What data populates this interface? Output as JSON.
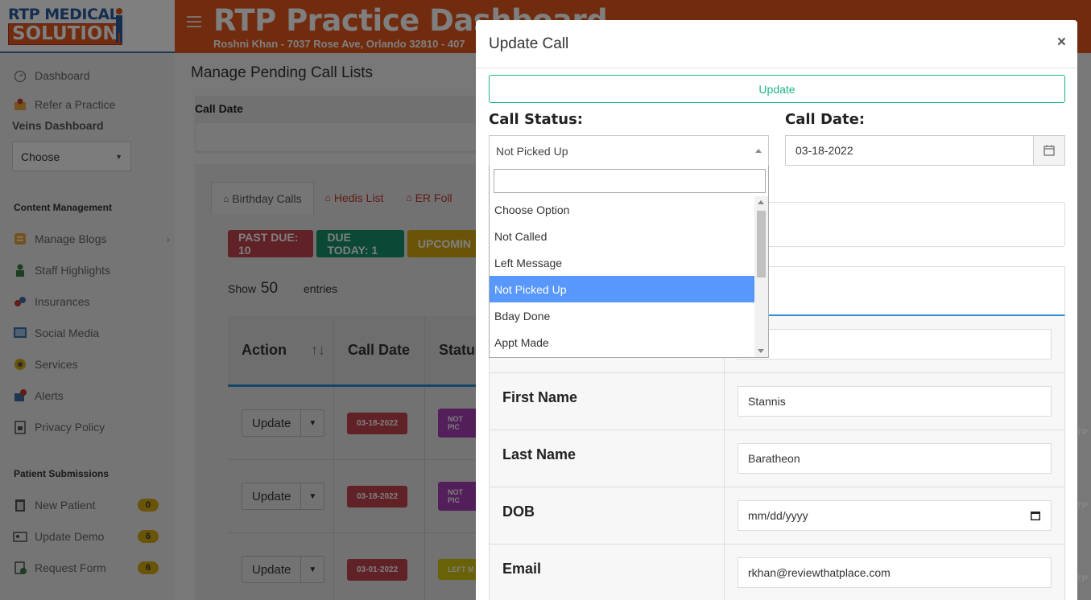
{
  "logo": {
    "line1": "RTP MEDICAL",
    "line2": "SOLUTION"
  },
  "header": {
    "title": "RTP Practice Dashboard",
    "subtitle": "Roshni Khan - 7037 Rose Ave, Orlando 32810 - 407",
    "bg_color": "#e2571c"
  },
  "sidebar": {
    "top_items": [
      {
        "label": "Dashboard",
        "icon": "gauge-icon"
      },
      {
        "label": "Refer a Practice",
        "icon": "refer-icon"
      }
    ],
    "veins_heading": "Veins Dashboard",
    "veins_select": "Choose",
    "content_heading": "Content Management",
    "content_items": [
      {
        "label": "Manage Blogs",
        "icon": "blog-icon"
      },
      {
        "label": "Staff Highlights",
        "icon": "staff-icon"
      },
      {
        "label": "Insurances",
        "icon": "insurance-icon"
      },
      {
        "label": "Social Media",
        "icon": "social-icon"
      },
      {
        "label": "Services",
        "icon": "services-icon"
      },
      {
        "label": "Alerts",
        "icon": "alert-icon"
      },
      {
        "label": "Privacy Policy",
        "icon": "privacy-icon"
      }
    ],
    "patient_heading": "Patient Submissions",
    "patient_items": [
      {
        "label": "New Patient",
        "count": "0",
        "icon": "clipboard-icon"
      },
      {
        "label": "Update Demo",
        "count": "6",
        "icon": "id-card-icon"
      },
      {
        "label": "Request Form",
        "count": "6",
        "icon": "form-icon"
      }
    ]
  },
  "main": {
    "page_title": "Manage Pending Call Lists",
    "filter_label": "Call Date",
    "tabs": [
      {
        "label": "Birthday Calls",
        "active": true
      },
      {
        "label": "Hedis List",
        "active": false
      },
      {
        "label": "ER Foll",
        "active": false
      }
    ],
    "pills": [
      {
        "label": "PAST DUE: 10",
        "color": "#c0444f"
      },
      {
        "label": "DUE TODAY: 1",
        "color": "#17906a"
      },
      {
        "label": "UPCOMIN",
        "color": "#d4a80f"
      }
    ],
    "show_label": "Show",
    "show_count": "50",
    "entries_label": "entries",
    "columns": [
      "Action",
      "Call Date",
      "Status"
    ],
    "rows": [
      {
        "action": "Update",
        "date": "03-18-2022",
        "status": "NOT PIC",
        "status_color": "#a63fb5"
      },
      {
        "action": "Update",
        "date": "03-18-2022",
        "status": "NOT PIC",
        "status_color": "#a63fb5"
      },
      {
        "action": "Update",
        "date": "03-01-2022",
        "status": "LEFT M",
        "status_color": "#d4c40f"
      }
    ]
  },
  "modal": {
    "title": "Update Call",
    "close": "×",
    "update_button": "Update",
    "call_status_label": "Call Status:",
    "call_status_value": "Not Picked Up",
    "call_date_label": "Call Date:",
    "call_date_value": "03-18-2022",
    "id_partial": "-1",
    "fields": [
      {
        "label": "First Name",
        "value": "Stannis"
      },
      {
        "label": "Last Name",
        "value": "Baratheon"
      },
      {
        "label": "DOB",
        "value": "mm/dd/yyyy"
      },
      {
        "label": "Email",
        "value": "rkhan@reviewthatplace.com"
      }
    ]
  },
  "dropdown": {
    "search_value": "",
    "options": [
      "Choose Option",
      "Not Called",
      "Left Message",
      "Not Picked Up",
      "Bday Done",
      "Appt Made"
    ],
    "selected_index": 3
  },
  "peek_text": "TP"
}
